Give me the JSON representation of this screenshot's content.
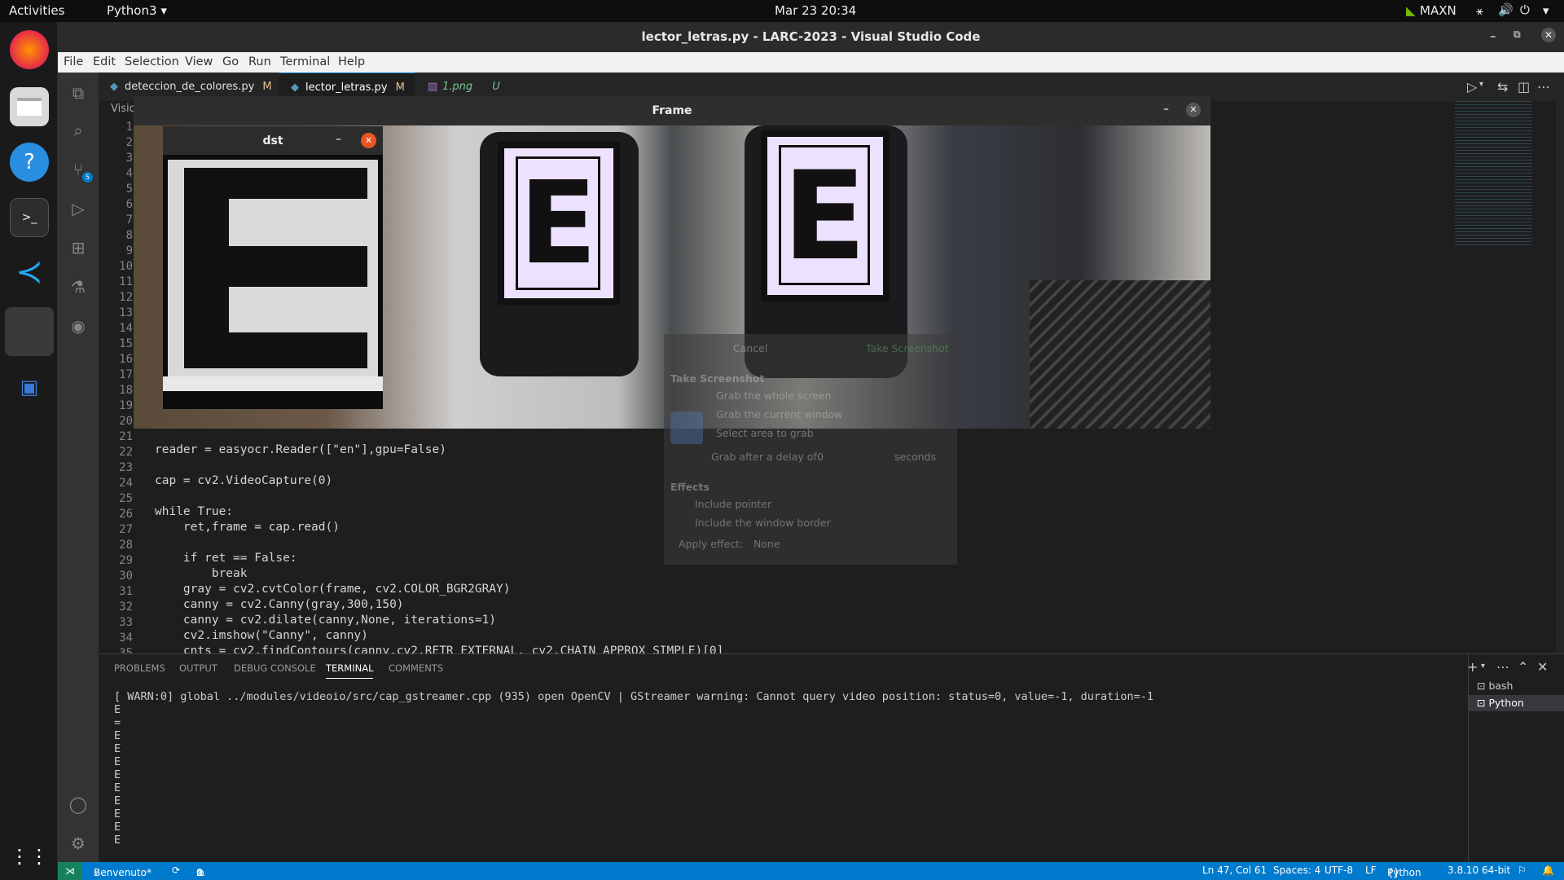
{
  "topbar": {
    "activities": "Activities",
    "app": "Python3",
    "clock": "Mar 23  20:34",
    "power_mode": "MAXN"
  },
  "dock": {
    "icons": [
      "firefox-icon",
      "files-icon",
      "help-icon",
      "terminal-icon",
      "vscode-icon",
      "active-app-icon",
      "window-icon",
      "show-apps-icon"
    ]
  },
  "window": {
    "title": "lector_letras.py - LARC-2023 - Visual Studio Code"
  },
  "menu": [
    "File",
    "Edit",
    "Selection",
    "View",
    "Go",
    "Run",
    "Terminal",
    "Help"
  ],
  "tabs": [
    {
      "label": "deteccion_de_colores.py",
      "badge": "M"
    },
    {
      "label": "lector_letras.py",
      "badge": "M"
    },
    {
      "label": "1.png",
      "badge": "U"
    }
  ],
  "breadcrumb": "Visio",
  "scm_badge": "5",
  "line_numbers": [
    "1",
    "2",
    "3",
    "4",
    "5",
    "6",
    "7",
    "8",
    "9",
    "10",
    "11",
    "12",
    "13",
    "14",
    "15",
    "16",
    "17",
    "18",
    "19",
    "20",
    "21",
    "22",
    "23",
    "24",
    "25",
    "26",
    "27",
    "28",
    "29",
    "30",
    "31",
    "32",
    "33",
    "34",
    "35"
  ],
  "code_lines": [
    {
      "n": 22,
      "text": "reader = easyocr.Reader([\"en\"],gpu=False)"
    },
    {
      "n": 23,
      "text": ""
    },
    {
      "n": 24,
      "text": "cap = cv2.VideoCapture(0)"
    },
    {
      "n": 25,
      "text": ""
    },
    {
      "n": 26,
      "text": "while True:"
    },
    {
      "n": 27,
      "text": "    ret,frame = cap.read()"
    },
    {
      "n": 28,
      "text": ""
    },
    {
      "n": 29,
      "text": "    if ret == False:"
    },
    {
      "n": 30,
      "text": "        break"
    },
    {
      "n": 31,
      "text": "    gray = cv2.cvtColor(frame, cv2.COLOR_BGR2GRAY)"
    },
    {
      "n": 32,
      "text": "    canny = cv2.Canny(gray,300,150)"
    },
    {
      "n": 33,
      "text": "    canny = cv2.dilate(canny,None, iterations=1)"
    },
    {
      "n": 34,
      "text": "    cv2.imshow(\"Canny\", canny)"
    },
    {
      "n": 35,
      "text": "    cnts = cv2.findContours(canny,cv2.RETR_EXTERNAL, cv2.CHAIN_APPROX_SIMPLE)[0]"
    }
  ],
  "frame_window": {
    "title": "Frame"
  },
  "dst_window": {
    "title": "dst"
  },
  "screenshot_dialog": {
    "cancel": "Cancel",
    "take": "Take Screenshot",
    "heading": "Take Screenshot",
    "opt1": "Grab the whole screen",
    "opt2": "Grab the current window",
    "opt3": "Select area to grab",
    "delay_label": "Grab after a delay of",
    "delay_value": "0",
    "delay_unit": "seconds",
    "effects": "Effects",
    "pointer": "Include pointer",
    "border": "Include the window border",
    "apply": "Apply effect:",
    "apply_value": "None"
  },
  "panel": {
    "tabs": [
      "PROBLEMS",
      "OUTPUT",
      "DEBUG CONSOLE",
      "TERMINAL",
      "COMMENTS"
    ],
    "active": "TERMINAL",
    "terminal_lines": [
      "[ WARN:0] global ../modules/videoio/src/cap_gstreamer.cpp (935) open OpenCV | GStreamer warning: Cannot query video position: status=0, value=-1, duration=-1",
      "E",
      "=",
      "E",
      "E",
      "E",
      "E",
      "E",
      "E",
      "E",
      "E",
      "E"
    ],
    "terminals": [
      "bash",
      "Python"
    ]
  },
  "status": {
    "branch": "Benvenuto*",
    "problems": "0",
    "warnings": "0",
    "position": "Ln 47, Col 61",
    "spaces": "Spaces: 4",
    "encoding": "UTF-8",
    "eol": "LF",
    "language": "Python",
    "interpreter": "3.8.10 64-bit"
  }
}
